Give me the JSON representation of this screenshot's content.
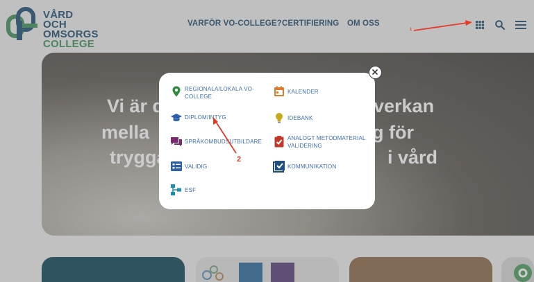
{
  "header": {
    "logo_line1": "VÅRD OCH",
    "logo_line2": "OMSORGS",
    "logo_line3": "COLLEGE",
    "nav": [
      "VARFÖR VO-COLLEGE?",
      "CERTIFIERING",
      "OM OSS"
    ],
    "icons": [
      "apps-grid-icon",
      "search-icon",
      "hamburger-menu-icon"
    ]
  },
  "hero": {
    "lines": [
      "Vi är d",
      "verkan",
      "mella",
      "g för",
      "trygga",
      "i vård"
    ]
  },
  "modal": {
    "items": [
      {
        "label_l1": "REGIONALA/LOKALA VO-",
        "label_l2": "COLLEGE",
        "icon": "map-pin-icon",
        "color": "#2e8b3e"
      },
      {
        "label_l1": "KALENDER",
        "label_l2": "",
        "icon": "calendar-icon",
        "color": "#e07b2e"
      },
      {
        "label_l1": "DIPLOM/INTYG",
        "label_l2": "",
        "icon": "graduation-cap-icon",
        "color": "#2b5fa8"
      },
      {
        "label_l1": "IDEBANK",
        "label_l2": "",
        "icon": "lightbulb-icon",
        "color": "#c9a81a"
      },
      {
        "label_l1": "SPRÅKOMBUDSUTBILDARE",
        "label_l2": "",
        "icon": "chat-bubbles-icon",
        "color": "#7a2a6f"
      },
      {
        "label_l1": "ANALOGT METODMATERIAL",
        "label_l2": "VALIDERING",
        "icon": "clipboard-check-icon",
        "color": "#c0392b"
      },
      {
        "label_l1": "VALIDIG",
        "label_l2": "",
        "icon": "checklist-icon",
        "color": "#2b5fa8"
      },
      {
        "label_l1": "KOMMUNIKATION",
        "label_l2": "",
        "icon": "checkbox-icon",
        "color": "#1f4f7a"
      },
      {
        "label_l1": "ESF",
        "label_l2": "",
        "icon": "network-icon",
        "color": "#1c8fb0"
      }
    ],
    "close_icon": "close-icon"
  },
  "annotations": {
    "arrow1_label": "1",
    "arrow2_label": "2",
    "color": "#e53a25"
  }
}
